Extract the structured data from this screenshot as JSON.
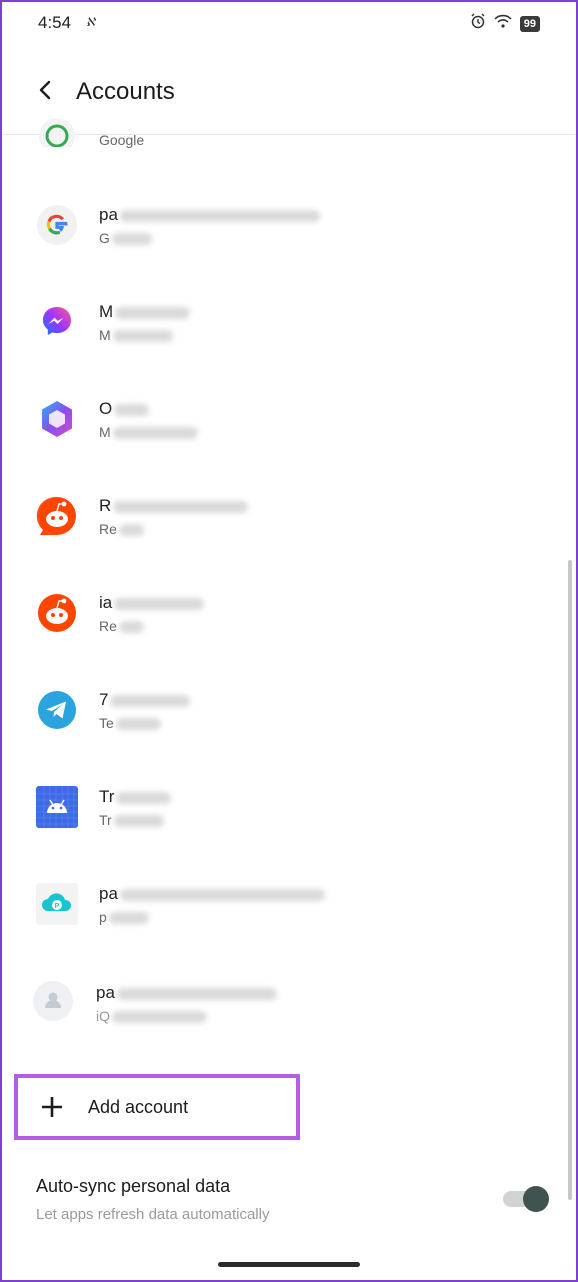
{
  "status_bar": {
    "time": "4:54",
    "extra": "ℵ",
    "battery": "99"
  },
  "app_bar": {
    "title": "Accounts"
  },
  "partial_item": {
    "type": "Google"
  },
  "accounts": [
    {
      "name": "pa",
      "type": "G",
      "icon": "google-icon"
    },
    {
      "name": "M",
      "type": "M",
      "icon": "messenger-icon"
    },
    {
      "name": "O",
      "type": "M",
      "icon": "office-icon"
    },
    {
      "name": "R",
      "type": "Re",
      "icon": "reddit-icon"
    },
    {
      "name": "ia",
      "type": "Re",
      "icon": "reddit-icon"
    },
    {
      "name": "7",
      "type": "Te",
      "icon": "telegram-icon"
    },
    {
      "name": "Tr",
      "type": "Tr",
      "icon": "android-icon"
    },
    {
      "name": "pa",
      "type": "p",
      "icon": "pcloud-icon"
    },
    {
      "name": "pa",
      "type": "iQ",
      "icon": "person-icon"
    }
  ],
  "add_account": {
    "label": "Add account"
  },
  "auto_sync": {
    "title": "Auto-sync personal data",
    "subtitle": "Let apps refresh data automatically",
    "enabled": true
  },
  "colors": {
    "highlight": "#b25ee6",
    "toggle_knob": "#3f5350",
    "reddit": "#ff4500",
    "telegram": "#2aa3df",
    "android": "#3d6ae6"
  }
}
